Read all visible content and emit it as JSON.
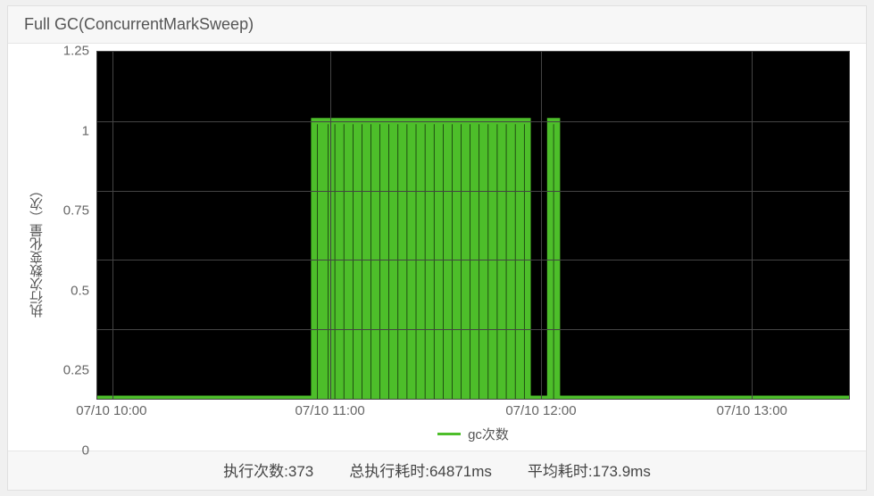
{
  "title": "Full GC(ConcurrentMarkSweep)",
  "ylabel": "执行次数变化量（次）",
  "legend": {
    "series_name": "gc次数",
    "series_color": "#4dbe2a"
  },
  "y_ticks": [
    "1.25",
    "1",
    "0.75",
    "0.5",
    "0.25",
    "0"
  ],
  "x_ticks": [
    {
      "label": "07/10 10:00",
      "pos": 0.02
    },
    {
      "label": "07/10 11:00",
      "pos": 0.31
    },
    {
      "label": "07/10 12:00",
      "pos": 0.59
    },
    {
      "label": "07/10 13:00",
      "pos": 0.87
    }
  ],
  "stats": {
    "count": "执行次数:373",
    "total": "总执行耗时:64871ms",
    "avg": "平均耗时:173.9ms"
  },
  "chart_data": {
    "type": "line",
    "title": "Full GC(ConcurrentMarkSweep)",
    "xlabel": "",
    "ylabel": "执行次数变化量（次）",
    "ylim": [
      0,
      1.25
    ],
    "series": [
      {
        "name": "gc次数",
        "color": "#4dbe2a",
        "x_range_hours": [
          "07/10 09:55",
          "07/10 13:30"
        ],
        "comment": "Value is 0 until roughly 07/10 10:55, then rapidly oscillates between 0 and 1 (many spikes up to 1 and back to 0) until about 07/10 11:58, a brief gap to 0, one more spike to 1 near 07/10 12:03, then 0 for the rest of the window.",
        "approx_spike_xs_frac": [
          0.293,
          0.307,
          0.316,
          0.328,
          0.34,
          0.352,
          0.364,
          0.376,
          0.388,
          0.4,
          0.412,
          0.424,
          0.436,
          0.448,
          0.46,
          0.472,
          0.484,
          0.496,
          0.508,
          0.52,
          0.532,
          0.544,
          0.556,
          0.568,
          0.607
        ],
        "spike_value": 1,
        "baseline_value": 0
      }
    ],
    "x_ticks": [
      "07/10 10:00",
      "07/10 11:00",
      "07/10 12:00",
      "07/10 13:00"
    ]
  }
}
